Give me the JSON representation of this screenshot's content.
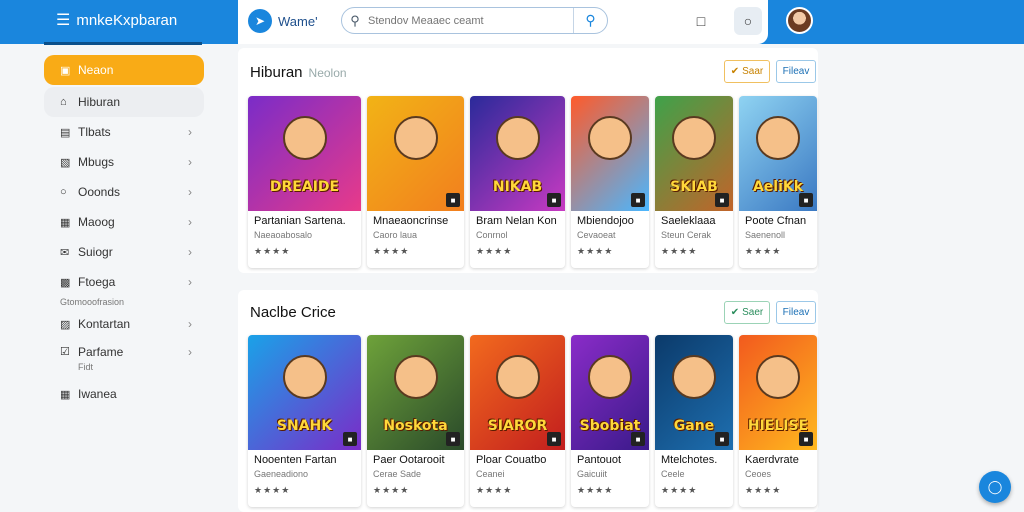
{
  "app": {
    "brand": "mnkeKxpbaran",
    "logo2": "Wame'"
  },
  "search": {
    "placeholder": "Stendov Meaaec ceamt"
  },
  "sidebar": {
    "items": [
      {
        "label": "Neaon",
        "icon": "store-icon",
        "active": true
      },
      {
        "label": "Hiburan",
        "icon": "home-icon",
        "highlight": true
      },
      {
        "label": "Tlbats",
        "icon": "book-icon",
        "chevron": true
      },
      {
        "label": "Mbugs",
        "icon": "music-icon",
        "chevron": true
      },
      {
        "label": "Ooonds",
        "icon": "disc-icon",
        "chevron": true
      },
      {
        "label": "Maoog",
        "icon": "calendar-icon",
        "chevron": true
      },
      {
        "label": "Suiogr",
        "icon": "mail-icon",
        "chevron": true
      },
      {
        "label": "Ftoega",
        "icon": "image-icon",
        "chevron": true
      }
    ],
    "section_label": "Gtomooofrasion",
    "items2": [
      {
        "label": "Kontartan",
        "icon": "tv-icon",
        "chevron": true
      },
      {
        "label": "Parfame",
        "sub": "Fidt",
        "icon": "check-icon",
        "chevron": true
      },
      {
        "label": "Iwanea",
        "icon": "grid-icon"
      }
    ]
  },
  "sections": [
    {
      "title": "Hiburan",
      "subtitle": "Neolon",
      "sort_label": "Saar",
      "filter_label": "Fileav",
      "cards": [
        {
          "art_text": "DREAIDE",
          "name": "Partanian Sartena.",
          "meta": "Naeaoabosalo",
          "colors": [
            "#7a2cc8",
            "#e83a8a"
          ]
        },
        {
          "art_text": "",
          "name": "Mnaeaoncrinse",
          "meta": "Caoro laua",
          "colors": [
            "#f2b316",
            "#f27f1e"
          ]
        },
        {
          "art_text": "NIKAB",
          "name": "Bram Nelan Kon",
          "meta": "Conrnol",
          "colors": [
            "#2a2a9a",
            "#c83ac2"
          ]
        },
        {
          "art_text": "",
          "name": "Mbiendojoo",
          "meta": "Cevaoeat",
          "colors": [
            "#ff5a2a",
            "#4ab7ff"
          ]
        },
        {
          "art_text": "SKIAB",
          "name": "Saeleklaaa",
          "meta": "Steun Cerak",
          "colors": [
            "#3ea24a",
            "#c2642a"
          ]
        },
        {
          "art_text": "AeliKk",
          "name": "Poote Cfnan",
          "meta": "Saenenoll",
          "colors": [
            "#8fd3f2",
            "#3a78c2"
          ]
        }
      ]
    },
    {
      "title": "Naclbe Crice",
      "subtitle": "",
      "sort_label": "Saer",
      "filter_label": "Fileav",
      "cards": [
        {
          "art_text": "SNAHK",
          "name": "Nooenten Fartan",
          "meta": "Gaeneadiono",
          "colors": [
            "#1aa2e8",
            "#7a2cc8"
          ]
        },
        {
          "art_text": "Noskota",
          "name": "Paer Ootarooit",
          "meta": "Cerae Sade",
          "colors": [
            "#6ea23a",
            "#2a4a2a"
          ]
        },
        {
          "art_text": "SIAROR",
          "name": "Ploar Couatbo",
          "meta": "Ceanei",
          "colors": [
            "#f26a1e",
            "#c21e1e"
          ]
        },
        {
          "art_text": "Sbobiat",
          "name": "Pantouot",
          "meta": "Gaicuiit",
          "colors": [
            "#8a2cc8",
            "#3a1a8a"
          ]
        },
        {
          "art_text": "Gane",
          "name": "Mtelchotes.",
          "meta": "Ceele",
          "colors": [
            "#0b3a6a",
            "#1e6fb0"
          ]
        },
        {
          "art_text": "HIELISE",
          "name": "Kaerdvrate",
          "meta": "Ceoes",
          "colors": [
            "#f25a1e",
            "#ffb81e"
          ]
        }
      ]
    }
  ]
}
